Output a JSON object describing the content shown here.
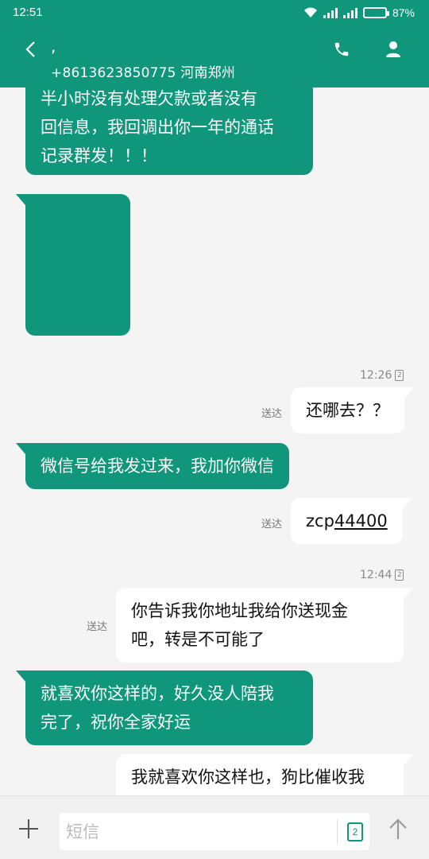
{
  "status": {
    "time": "12:51",
    "battery": "87%",
    "battery_level": 0.87
  },
  "header": {
    "contact_name": ",",
    "contact_number": "+8613623850775 河南郑州"
  },
  "messages": {
    "m1": {
      "lines": [
        "半小时没有处理欠款或者没有",
        "回信息，我回调出你一年的通话",
        "记录群发！！！"
      ]
    },
    "t1": {
      "time": "12:26",
      "sim": "2"
    },
    "m3": {
      "text": "还哪去？？",
      "status": "送达"
    },
    "m4": {
      "text": "微信号给我发过来，我加你微信"
    },
    "m5": {
      "text_prefix": "zcp",
      "text_link": "44400",
      "status": "送达"
    },
    "t2": {
      "time": "12:44",
      "sim": "2"
    },
    "m6": {
      "lines": [
        "你告诉我你地址我给你送现金",
        "吧，转是不可能了"
      ],
      "status": "送达"
    },
    "m7": {
      "lines": [
        "就喜欢你这样的，好久没人陪我",
        "完了，祝你全家好运"
      ]
    },
    "m8": {
      "lines": [
        "我就喜欢你这样也，狗比催收我"
      ]
    }
  },
  "composer": {
    "placeholder": "短信",
    "sim": "2"
  },
  "colors": {
    "brand": "#10967b",
    "incoming": "#10967b",
    "outgoing": "#ffffff"
  }
}
